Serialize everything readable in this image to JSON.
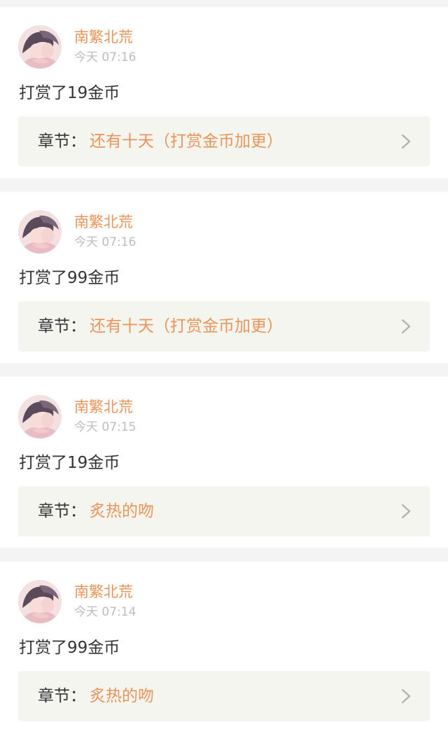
{
  "colors": {
    "accent": "#e8945a",
    "text": "#333333",
    "muted": "#bdbdbd",
    "chapter_bg": "#f5f5ef",
    "page_bg": "#f4f4f4",
    "card_bg": "#ffffff"
  },
  "feed": {
    "items": [
      {
        "username": "南繁北荒",
        "timestamp": "今天 07:16",
        "action": "打赏了19金币",
        "chapter_prefix": "章节：",
        "chapter_title": "还有十天（打赏金币加更）",
        "chevron_icon": "chevron-right-icon",
        "avatar_icon": "avatar-illustration"
      },
      {
        "username": "南繁北荒",
        "timestamp": "今天 07:16",
        "action": "打赏了99金币",
        "chapter_prefix": "章节：",
        "chapter_title": "还有十天（打赏金币加更）",
        "chevron_icon": "chevron-right-icon",
        "avatar_icon": "avatar-illustration"
      },
      {
        "username": "南繁北荒",
        "timestamp": "今天 07:15",
        "action": "打赏了19金币",
        "chapter_prefix": "章节：",
        "chapter_title": "炙热的吻",
        "chevron_icon": "chevron-right-icon",
        "avatar_icon": "avatar-illustration"
      },
      {
        "username": "南繁北荒",
        "timestamp": "今天 07:14",
        "action": "打赏了99金币",
        "chapter_prefix": "章节：",
        "chapter_title": "炙热的吻",
        "chevron_icon": "chevron-right-icon",
        "avatar_icon": "avatar-illustration"
      }
    ]
  }
}
